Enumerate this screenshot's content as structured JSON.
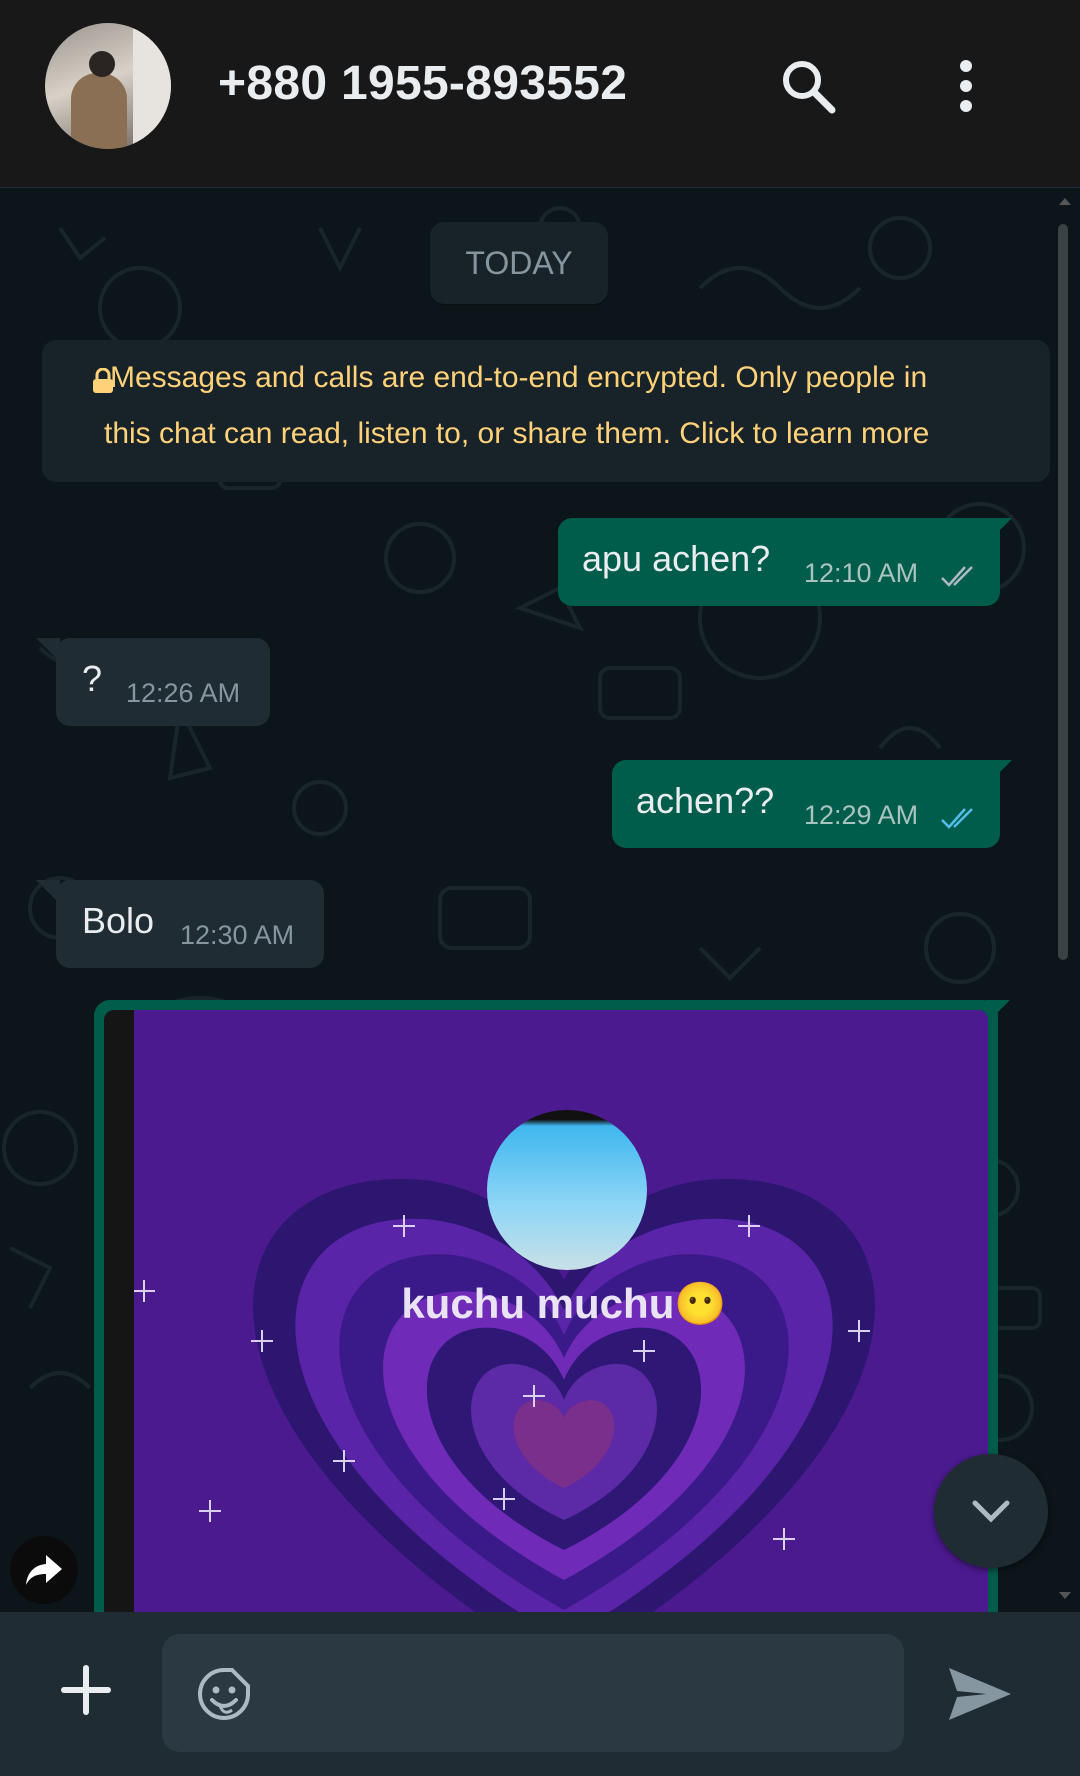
{
  "header": {
    "contact_name": "+880 1955-893552",
    "icons": [
      "avatar",
      "search-icon",
      "more-vertical-icon"
    ]
  },
  "chat": {
    "date_chip": "TODAY",
    "encryption_notice": {
      "line1": "Messages and calls are end-to-end encrypted. Only people in",
      "line2": "this chat can read, listen to, or share them. Click to learn more",
      "icon": "lock-icon"
    },
    "messages": [
      {
        "direction": "outgoing",
        "text": "apu achen?",
        "time": "12:10 AM",
        "status": "delivered"
      },
      {
        "direction": "incoming",
        "text": "?",
        "time": "12:26 AM"
      },
      {
        "direction": "outgoing",
        "text": "achen??",
        "time": "12:29 AM",
        "status": "read"
      },
      {
        "direction": "incoming",
        "text": "Bolo",
        "time": "12:30 AM"
      }
    ],
    "media_message": {
      "direction": "outgoing",
      "caption": "kuchu muchu😶"
    }
  },
  "colors": {
    "header_bg": "#181818",
    "chat_bg": "#0b141a",
    "outgoing_bubble": "#005c4b",
    "incoming_bubble": "#202c33",
    "encryption_text": "#ffd279",
    "read_tick": "#53bdeb"
  },
  "footer": {
    "message_placeholder": "",
    "icons": [
      "plus-icon",
      "sticker-icon",
      "send-icon"
    ]
  }
}
